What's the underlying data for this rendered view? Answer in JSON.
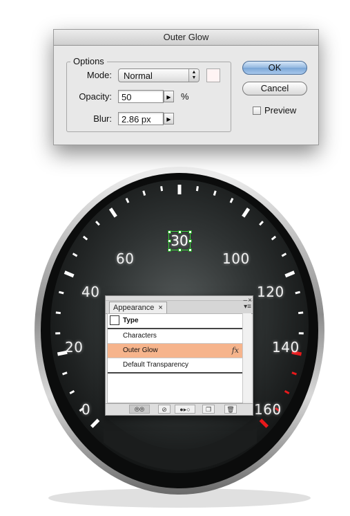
{
  "dialog": {
    "title": "Outer Glow",
    "options_legend": "Options",
    "mode_label": "Mode:",
    "mode_value": "Normal",
    "opacity_label": "Opacity:",
    "opacity_value": "50",
    "opacity_unit": "%",
    "blur_label": "Blur:",
    "blur_value": "2.86 px",
    "ok_label": "OK",
    "cancel_label": "Cancel",
    "preview_label": "Preview",
    "glow_color": "#fff4f4"
  },
  "speedometer": {
    "labels": [
      "0",
      "20",
      "40",
      "60",
      "100",
      "120",
      "140",
      "160"
    ],
    "selected_label": "30",
    "redline_color": "#e8191b",
    "tick_color": "#ffffff"
  },
  "appearance": {
    "tab_label": "Appearance",
    "tab_close": "×",
    "rows": [
      "Type",
      "Characters",
      "Outer Glow",
      "Default Transparency"
    ],
    "fx_label": "fx",
    "selected_row_color": "#f6b48c"
  }
}
